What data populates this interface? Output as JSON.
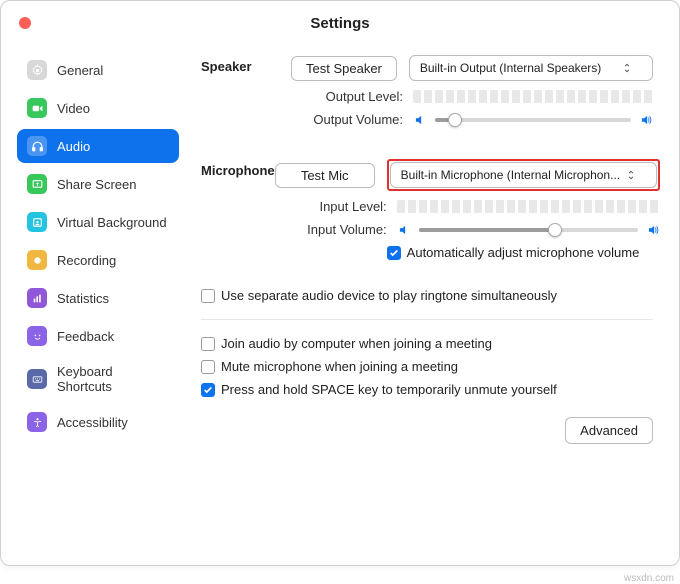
{
  "title": "Settings",
  "sidebar": {
    "items": [
      {
        "label": "General"
      },
      {
        "label": "Video"
      },
      {
        "label": "Audio"
      },
      {
        "label": "Share Screen"
      },
      {
        "label": "Virtual Background"
      },
      {
        "label": "Recording"
      },
      {
        "label": "Statistics"
      },
      {
        "label": "Feedback"
      },
      {
        "label": "Keyboard Shortcuts"
      },
      {
        "label": "Accessibility"
      }
    ]
  },
  "speaker": {
    "heading": "Speaker",
    "test_btn": "Test Speaker",
    "device": "Built-in Output (Internal Speakers)",
    "output_level_label": "Output Level:",
    "output_volume_label": "Output Volume:"
  },
  "microphone": {
    "heading": "Microphone",
    "test_btn": "Test Mic",
    "device": "Built-in Microphone (Internal Microphon...",
    "input_level_label": "Input Level:",
    "input_volume_label": "Input Volume:",
    "auto_adjust": "Automatically adjust microphone volume"
  },
  "options": {
    "separate_device": "Use separate audio device to play ringtone simultaneously",
    "join_by_computer": "Join audio by computer when joining a meeting",
    "mute_on_join": "Mute microphone when joining a meeting",
    "space_unmute": "Press and hold SPACE key to temporarily unmute yourself"
  },
  "advanced_btn": "Advanced",
  "watermark": "wsxdn.com"
}
